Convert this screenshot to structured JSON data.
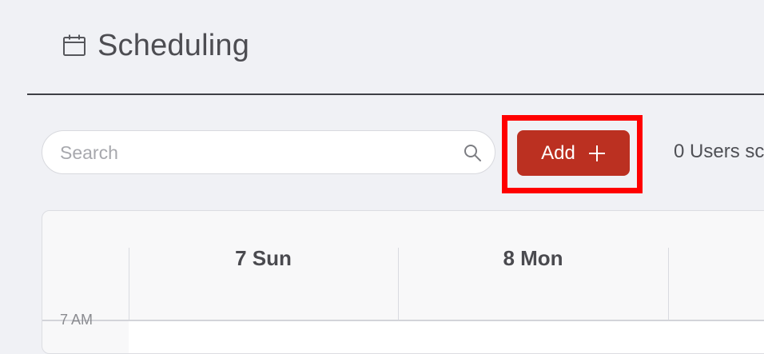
{
  "header": {
    "icon": "calendar-icon",
    "title": "Scheduling"
  },
  "search": {
    "placeholder": "Search",
    "value": "",
    "icon": "search-icon"
  },
  "add_button": {
    "label": "Add",
    "icon": "plus-icon",
    "color": "#bb3021"
  },
  "users_scheduled_text": "0 Users sc",
  "calendar": {
    "days": [
      {
        "label": "7 Sun"
      },
      {
        "label": "8 Mon"
      }
    ],
    "time_labels": [
      "7 AM"
    ]
  },
  "colors": {
    "background": "#f0f1f5",
    "highlight": "#ff0000",
    "accent": "#bb3021"
  }
}
